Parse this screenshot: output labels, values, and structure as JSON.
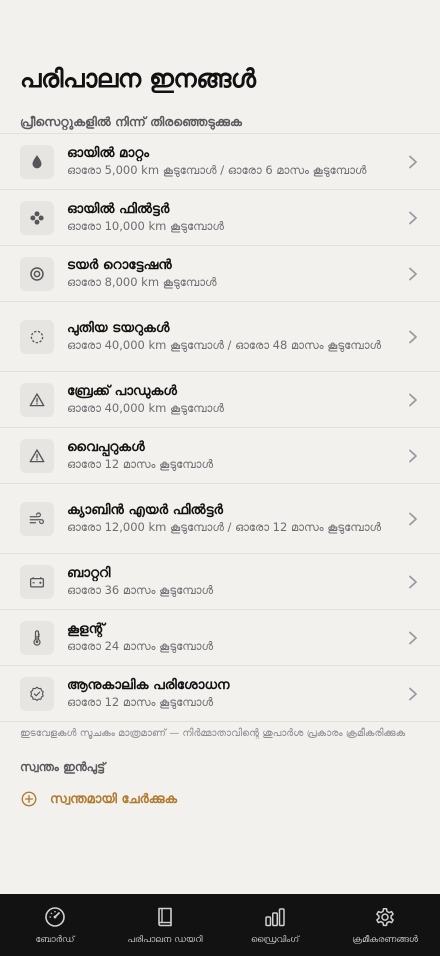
{
  "page": {
    "title": "പരിപാലന ഇനങ്ങൾ",
    "section_label": "പ്രീസെറ്റുകളിൽ നിന്ന് തിരഞ്ഞെടുക്കുക"
  },
  "items": [
    {
      "title": "ഓയിൽ മാറ്റം",
      "subtitle": "ഓരോ 5,000 km കൂടുമ്പോൾ / ഓരോ 6 മാസം കൂടുമ്പോൾ",
      "icon": "drop-icon"
    },
    {
      "title": "ഓയിൽ ഫിൽട്ടർ",
      "subtitle": "ഓരോ 10,000 km കൂടുമ്പോൾ",
      "icon": "filter-icon"
    },
    {
      "title": "ടയർ റൊട്ടേഷൻ",
      "subtitle": "ഓരോ 8,000 km കൂടുമ്പോൾ",
      "icon": "tire-icon"
    },
    {
      "title": "പുതിയ ടയറുകൾ",
      "subtitle": "ഓരോ 40,000 km കൂടുമ്പോൾ / ഓരോ 48 മാസം കൂടുമ്പോൾ",
      "icon": "dashed-circle-icon"
    },
    {
      "title": "ബ്രേക്ക് പാഡുകൾ",
      "subtitle": "ഓരോ 40,000 km കൂടുമ്പോൾ",
      "icon": "warning-icon"
    },
    {
      "title": "വൈപ്പറുകൾ",
      "subtitle": "ഓരോ 12 മാസം കൂടുമ്പോൾ",
      "icon": "warning-icon"
    },
    {
      "title": "ക്യാബിൻ എയർ ഫിൽട്ടർ",
      "subtitle": "ഓരോ 12,000 km കൂടുമ്പോൾ / ഓരോ 12 മാസം കൂടുമ്പോൾ",
      "icon": "wind-icon"
    },
    {
      "title": "ബാറ്ററി",
      "subtitle": "ഓരോ 36 മാസം കൂടുമ്പോൾ",
      "icon": "battery-icon"
    },
    {
      "title": "കൂളന്റ്",
      "subtitle": "ഓരോ 24 മാസം കൂടുമ്പോൾ",
      "icon": "thermometer-icon"
    },
    {
      "title": "ആനുകാലിക പരിശോധന",
      "subtitle": "ഓരോ 12 മാസം കൂടുമ്പോൾ",
      "icon": "check-badge-icon"
    }
  ],
  "footnote": "ഇടവേളകൾ സൂചകം മാത്രമാണ് — നിർമ്മാതാവിന്റെ ശുപാർശ പ്രകാരം ക്രമീകരിക്കുക",
  "custom": {
    "section_label": "സ്വന്തം ഇൻപുട്ട്",
    "add_label": "സ്വന്തമായി ചേർക്കുക"
  },
  "tabs": [
    {
      "label": "ബോർഡ്",
      "icon": "gauge-icon"
    },
    {
      "label": "പരിപാലന ഡയറി",
      "icon": "book-icon"
    },
    {
      "label": "ഡ്രൈവിംഗ്",
      "icon": "bar-chart-icon"
    },
    {
      "label": "ക്രമീകരണങ്ങൾ",
      "icon": "gear-icon"
    }
  ],
  "colors": {
    "accent": "#b07a2e",
    "background": "#f2f1ee",
    "tabbar": "#121212"
  }
}
